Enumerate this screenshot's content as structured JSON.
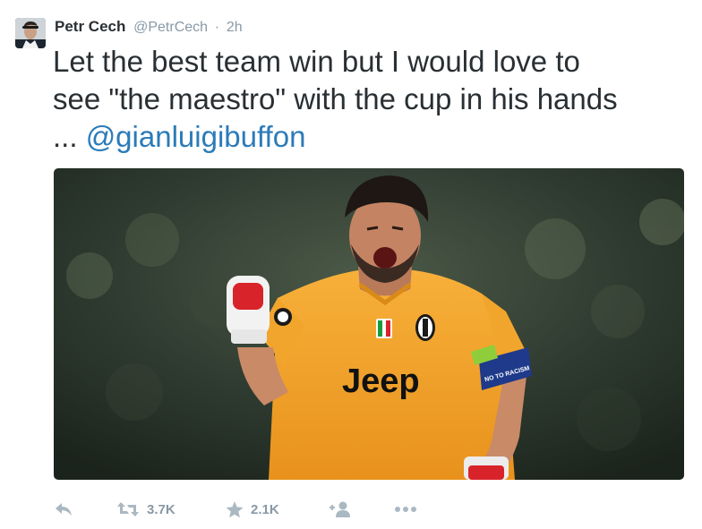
{
  "author": {
    "name": "Petr Cech",
    "handle": "@PetrCech",
    "separator": "·",
    "time": "2h"
  },
  "tweet": {
    "text_line1": "Let the best team win but I would love to",
    "text_line2": "see \"the maestro\" with the cup in his hands",
    "text_prefix": "... ",
    "mention": "@gianluigibuffon"
  },
  "media": {
    "jersey_text": "Jeep",
    "armband_text": "NO TO RACISM"
  },
  "actions": {
    "reply_icon": "reply-icon",
    "retweet_icon": "retweet-icon",
    "retweet_count": "3.7K",
    "favorite_icon": "star-icon",
    "favorite_count": "2.1K",
    "follow_icon": "add-user-icon",
    "more_icon": "more-icon"
  },
  "colors": {
    "text": "#292f33",
    "muted": "#8899a6",
    "link": "#2b7bb9",
    "jersey": "#f5a623"
  }
}
